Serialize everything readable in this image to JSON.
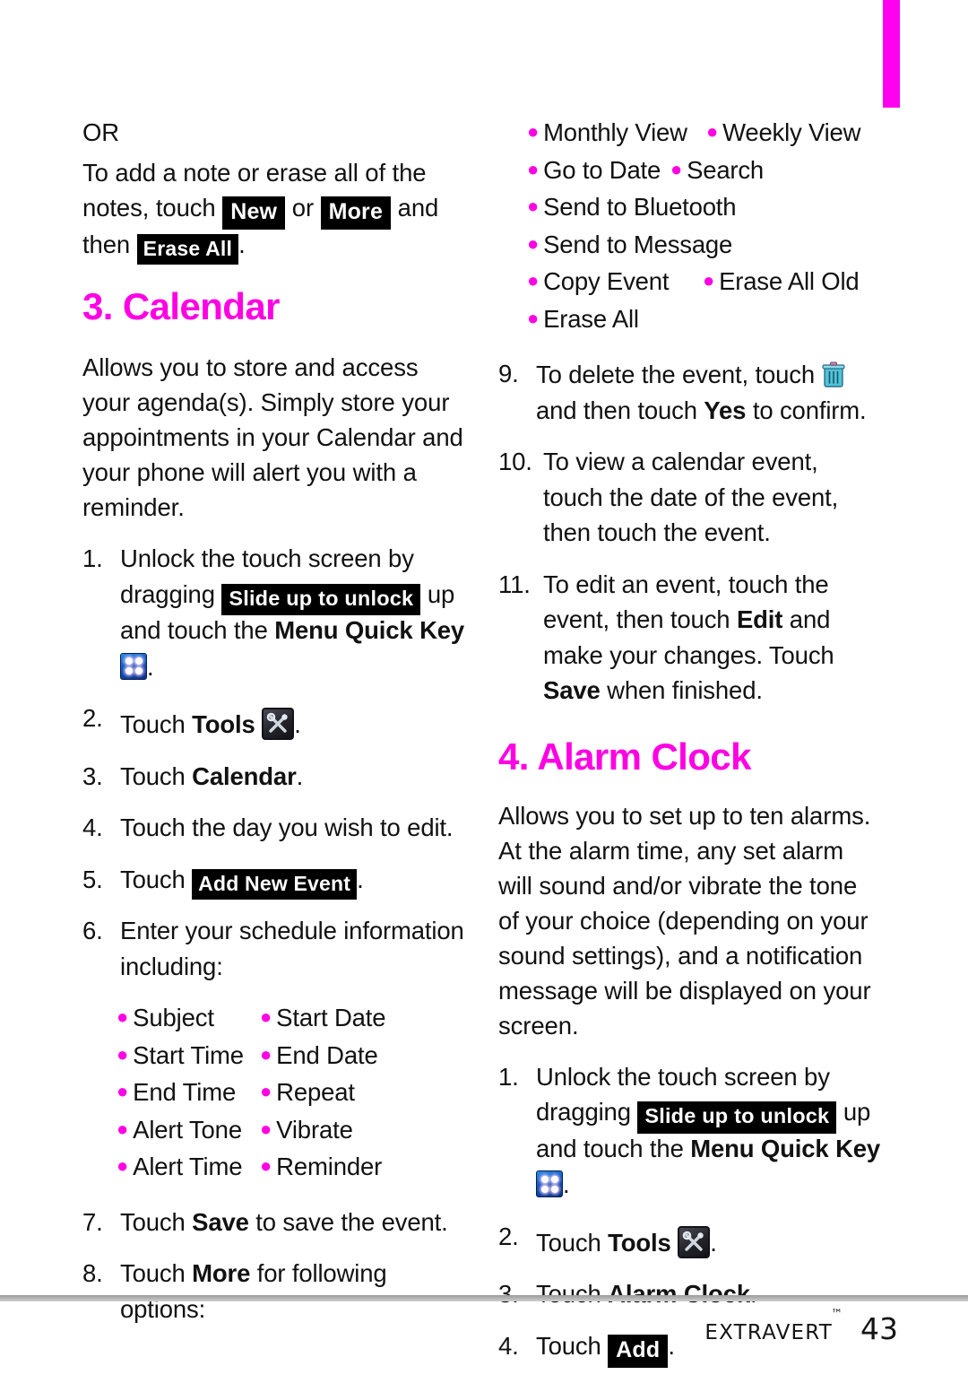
{
  "page": {
    "number": "43",
    "brand": "Extravert",
    "trademark": "™",
    "accent_color": "#FF00E4",
    "tab_color": "#FF00F0"
  },
  "left_column": {
    "or_label": "OR",
    "note_intro": {
      "part1": "To add a note or erase all of the notes, touch",
      "key_new": "New",
      "conj": "or",
      "key_more": "More",
      "part2": "and then",
      "key_erase_all": "Erase All",
      "period": "."
    },
    "calendar": {
      "heading": "3. Calendar",
      "description": "Allows you to store and access your agenda(s). Simply store your appointments in your Calendar and your phone will alert you with a reminder.",
      "steps": [
        {
          "num": "1.",
          "text_a": "Unlock the touch screen by dragging",
          "key": "Slide up to unlock",
          "text_b": "up and touch the",
          "bold": "Menu Quick Key",
          "icon": "menu-quick-key-icon",
          "text_c": "."
        },
        {
          "num": "2.",
          "text_a": "Touch",
          "bold": "Tools",
          "icon": "tools-icon",
          "text_c": "."
        },
        {
          "num": "3.",
          "text_a": "Touch",
          "bold": "Calendar",
          "text_c": "."
        },
        {
          "num": "4.",
          "text_a": "Touch the day you wish to edit."
        },
        {
          "num": "5.",
          "text_a": "Touch",
          "key": "Add New Event",
          "text_c": "."
        },
        {
          "num": "6.",
          "text_a": "Enter your schedule information including:"
        }
      ],
      "schedule_fields": [
        [
          "Subject",
          "Start Date"
        ],
        [
          "Start Time",
          "End Date"
        ],
        [
          "End Time",
          "Repeat"
        ],
        [
          "Alert Tone",
          "Vibrate"
        ],
        [
          "Alert Time",
          "Reminder"
        ]
      ],
      "step7": {
        "num": "7.",
        "text_a": "Touch",
        "bold": "Save",
        "text_b": "to save the event."
      },
      "step8": {
        "num": "8.",
        "text_a": "Touch",
        "bold": "More",
        "text_b": "for following options:"
      }
    }
  },
  "right_column": {
    "more_options": [
      [
        "Monthly View",
        "Weekly View"
      ],
      [
        "Go to Date",
        "Search"
      ],
      [
        "Send to Bluetooth",
        ""
      ],
      [
        "Send to Message",
        ""
      ],
      [
        "Copy Event",
        "Erase All Old"
      ],
      [
        "Erase All",
        ""
      ]
    ],
    "steps": [
      {
        "num": "9.",
        "text_a": "To delete the event, touch",
        "icon": "trash-icon",
        "text_b": "and then touch",
        "bold": "Yes",
        "text_c": "to confirm."
      },
      {
        "num": "10.",
        "text_a": "To view a calendar event, touch the date of the event, then touch the event."
      },
      {
        "num": "11.",
        "text_a": "To edit an event, touch the event, then touch",
        "bold": "Edit",
        "text_b": "and make your changes. Touch",
        "bold2": "Save",
        "text_c": "when finished."
      }
    ],
    "alarm": {
      "heading": "4. Alarm Clock",
      "description": "Allows you to set up to ten alarms. At the alarm time, any set alarm will sound and/or vibrate the tone of your choice (depending on your sound settings), and a notification message will be displayed on your screen.",
      "steps": [
        {
          "num": "1.",
          "text_a": "Unlock the touch screen by dragging",
          "key": "Slide up to unlock",
          "text_b": "up and touch the",
          "bold": "Menu Quick Key",
          "icon": "menu-quick-key-icon",
          "text_c": "."
        },
        {
          "num": "2.",
          "text_a": "Touch",
          "bold": "Tools",
          "icon": "tools-icon",
          "text_c": "."
        },
        {
          "num": "3.",
          "text_a": "Touch",
          "bold": "Alarm Clock",
          "text_c": "."
        },
        {
          "num": "4.",
          "text_a": "Touch",
          "key": "Add",
          "text_c": "."
        }
      ]
    }
  }
}
